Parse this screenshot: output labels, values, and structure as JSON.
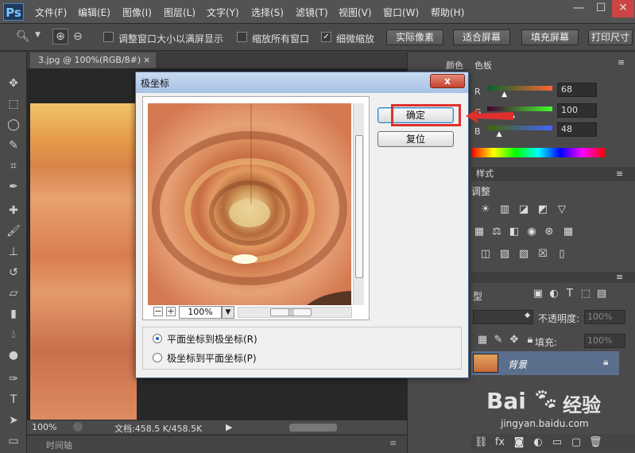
{
  "app": {
    "logo": "Ps"
  },
  "menu": [
    "文件(F)",
    "编辑(E)",
    "图像(I)",
    "图层(L)",
    "文字(Y)",
    "选择(S)",
    "滤镜(T)",
    "视图(V)",
    "窗口(W)",
    "帮助(H)"
  ],
  "options_bar": {
    "fit_window_label": "调整窗口大小以满屏显示",
    "zoom_all_label": "缩放所有窗口",
    "scrubby_label": "细微缩放",
    "actual_pixels": "实际像素",
    "fit_screen": "适合屏幕",
    "fill_screen": "填充屏幕",
    "print_size": "打印尺寸",
    "fit_window_checked": false,
    "zoom_all_checked": false,
    "scrubby_checked": true
  },
  "document": {
    "tab_title": "3.jpg @ 100%(RGB/8#)",
    "close": "×",
    "zoom": "100%",
    "doc_size": "文档:458.5 K/458.5K",
    "timeline": "时间轴"
  },
  "color_panel": {
    "tabs": [
      "颜色",
      "色板"
    ],
    "channels": [
      {
        "label": "R",
        "value": "68",
        "fraction": 0.27
      },
      {
        "label": "G",
        "value": "100",
        "fraction": 0.39
      },
      {
        "label": "B",
        "value": "48",
        "fraction": 0.19
      }
    ]
  },
  "adjust_panel": {
    "tabs": [
      "样式"
    ],
    "title": "调整"
  },
  "layers_panel": {
    "kind_label": "型",
    "opacity_label": "不透明度:",
    "opacity_value": "100%",
    "fill_label": "填充:",
    "fill_value": "100%",
    "layer_name": "背景"
  },
  "dialog": {
    "title": "极坐标",
    "close": "x",
    "ok": "确定",
    "reset": "复位",
    "zoom_value": "100%",
    "option_rect_to_polar": "平面坐标到极坐标(R)",
    "option_polar_to_rect": "极坐标到平面坐标(P)",
    "selected_option": "rect_to_polar"
  },
  "watermark": {
    "brand_left": "Bai",
    "brand_right": "经验",
    "url": "jingyan.baidu.com"
  },
  "colors": {
    "highlight": "#e0302e",
    "ps_bg": "#535353"
  }
}
